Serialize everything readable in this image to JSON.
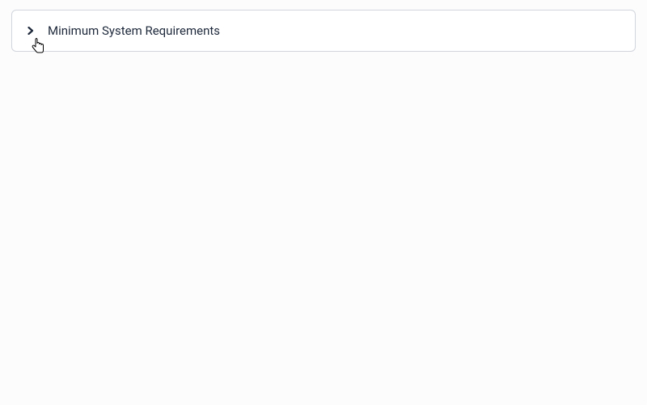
{
  "accordion": {
    "title": "Minimum System Requirements",
    "expanded": false
  }
}
